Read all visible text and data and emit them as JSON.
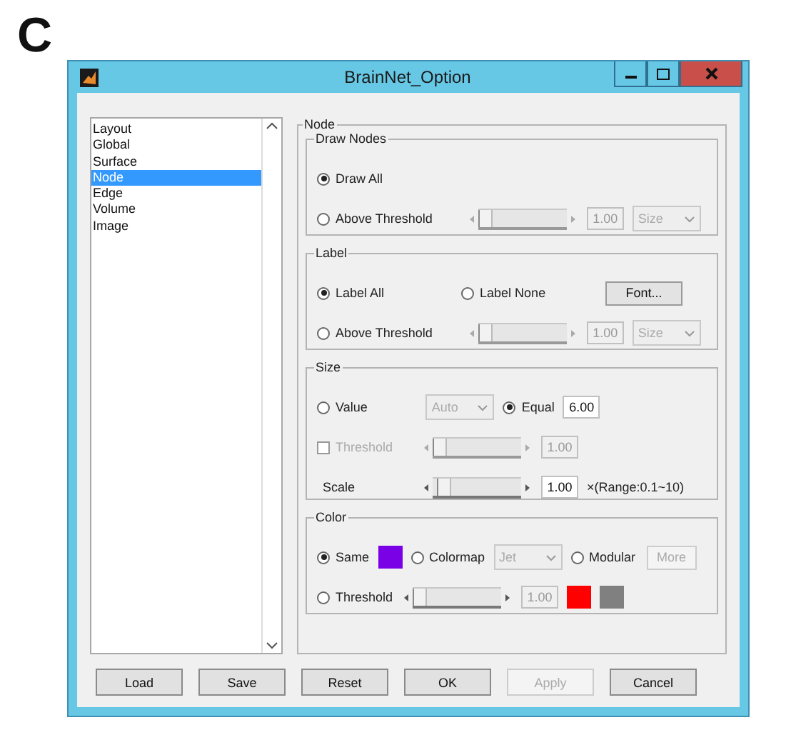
{
  "figure_label": "C",
  "window": {
    "title": "BrainNet_Option"
  },
  "sidebar": {
    "items": [
      {
        "label": "Layout",
        "selected": false
      },
      {
        "label": "Global",
        "selected": false
      },
      {
        "label": "Surface",
        "selected": false
      },
      {
        "label": "Node",
        "selected": true
      },
      {
        "label": "Edge",
        "selected": false
      },
      {
        "label": "Volume",
        "selected": false
      },
      {
        "label": "Image",
        "selected": false
      }
    ]
  },
  "panel": {
    "title": "Node",
    "groups": [
      {
        "title": "Draw Nodes",
        "rows": [
          [
            {
              "kind": "radio",
              "label": "Draw All",
              "selected": true
            }
          ],
          [
            {
              "kind": "radio",
              "label": "Above Threshold",
              "selected": false
            },
            {
              "kind": "slider",
              "level": 0,
              "disabled": true
            },
            {
              "kind": "field",
              "value": "1.00",
              "disabled": true
            },
            {
              "kind": "dropdown",
              "value": "Size",
              "disabled": true
            }
          ]
        ]
      },
      {
        "title": "Label",
        "rows": [
          [
            {
              "kind": "radio",
              "label": "Label All",
              "selected": true
            },
            {
              "kind": "radio",
              "label": "Label None",
              "selected": false
            },
            "",
            {
              "kind": "button",
              "label": "Font...",
              "disabled": false
            }
          ],
          [
            {
              "kind": "radio",
              "label": "Above Threshold",
              "selected": false
            },
            {
              "kind": "slider",
              "level": 0,
              "disabled": true
            },
            {
              "kind": "field",
              "value": "1.00",
              "disabled": true
            },
            {
              "kind": "dropdown",
              "value": "Size",
              "disabled": true
            }
          ]
        ]
      },
      {
        "title": "Size",
        "rows": [
          [
            {
              "kind": "radio",
              "label": "Value",
              "selected": false
            },
            {
              "kind": "dropdown",
              "value": "Auto",
              "disabled": true
            },
            {
              "kind": "radio",
              "label": "Equal",
              "selected": true
            },
            {
              "kind": "field",
              "value": "6.00",
              "disabled": false
            }
          ],
          [
            {
              "kind": "checkbox",
              "label": "Threshold",
              "checked": false,
              "disabled": true
            },
            {
              "kind": "slider",
              "level": 0,
              "disabled": true
            },
            {
              "kind": "field",
              "value": "1.00",
              "disabled": true
            }
          ],
          [
            {
              "kind": "label",
              "label": "Scale"
            },
            {
              "kind": "slider",
              "level": 0.06,
              "disabled": false
            },
            {
              "kind": "field",
              "value": "1.00",
              "disabled": false
            },
            {
              "kind": "text",
              "label": "×(Range:0.1~10)"
            }
          ]
        ]
      },
      {
        "title": "Color",
        "rows": [
          [
            {
              "kind": "radio",
              "label": "Same",
              "selected": true
            },
            {
              "kind": "swatch",
              "color": "#7a00e6"
            },
            {
              "kind": "radio",
              "label": "Colormap",
              "selected": false
            },
            {
              "kind": "dropdown",
              "value": "Jet",
              "disabled": true
            },
            {
              "kind": "radio",
              "label": "Modular",
              "selected": false
            },
            {
              "kind": "button",
              "label": "More",
              "disabled": true
            }
          ],
          [
            {
              "kind": "radio",
              "label": "Threshold",
              "selected": false
            },
            {
              "kind": "slider",
              "level": 0,
              "disabled": false
            },
            {
              "kind": "field",
              "value": "1.00",
              "disabled": true
            },
            {
              "kind": "swatch",
              "color": "#ff0000"
            },
            {
              "kind": "swatch",
              "color": "#808080"
            }
          ]
        ]
      }
    ]
  },
  "buttons": [
    {
      "label": "Load",
      "disabled": false
    },
    {
      "label": "Save",
      "disabled": false
    },
    {
      "label": "Reset",
      "disabled": false
    },
    {
      "label": "OK",
      "disabled": false
    },
    {
      "label": "Apply",
      "disabled": true
    },
    {
      "label": "Cancel",
      "disabled": false
    }
  ]
}
